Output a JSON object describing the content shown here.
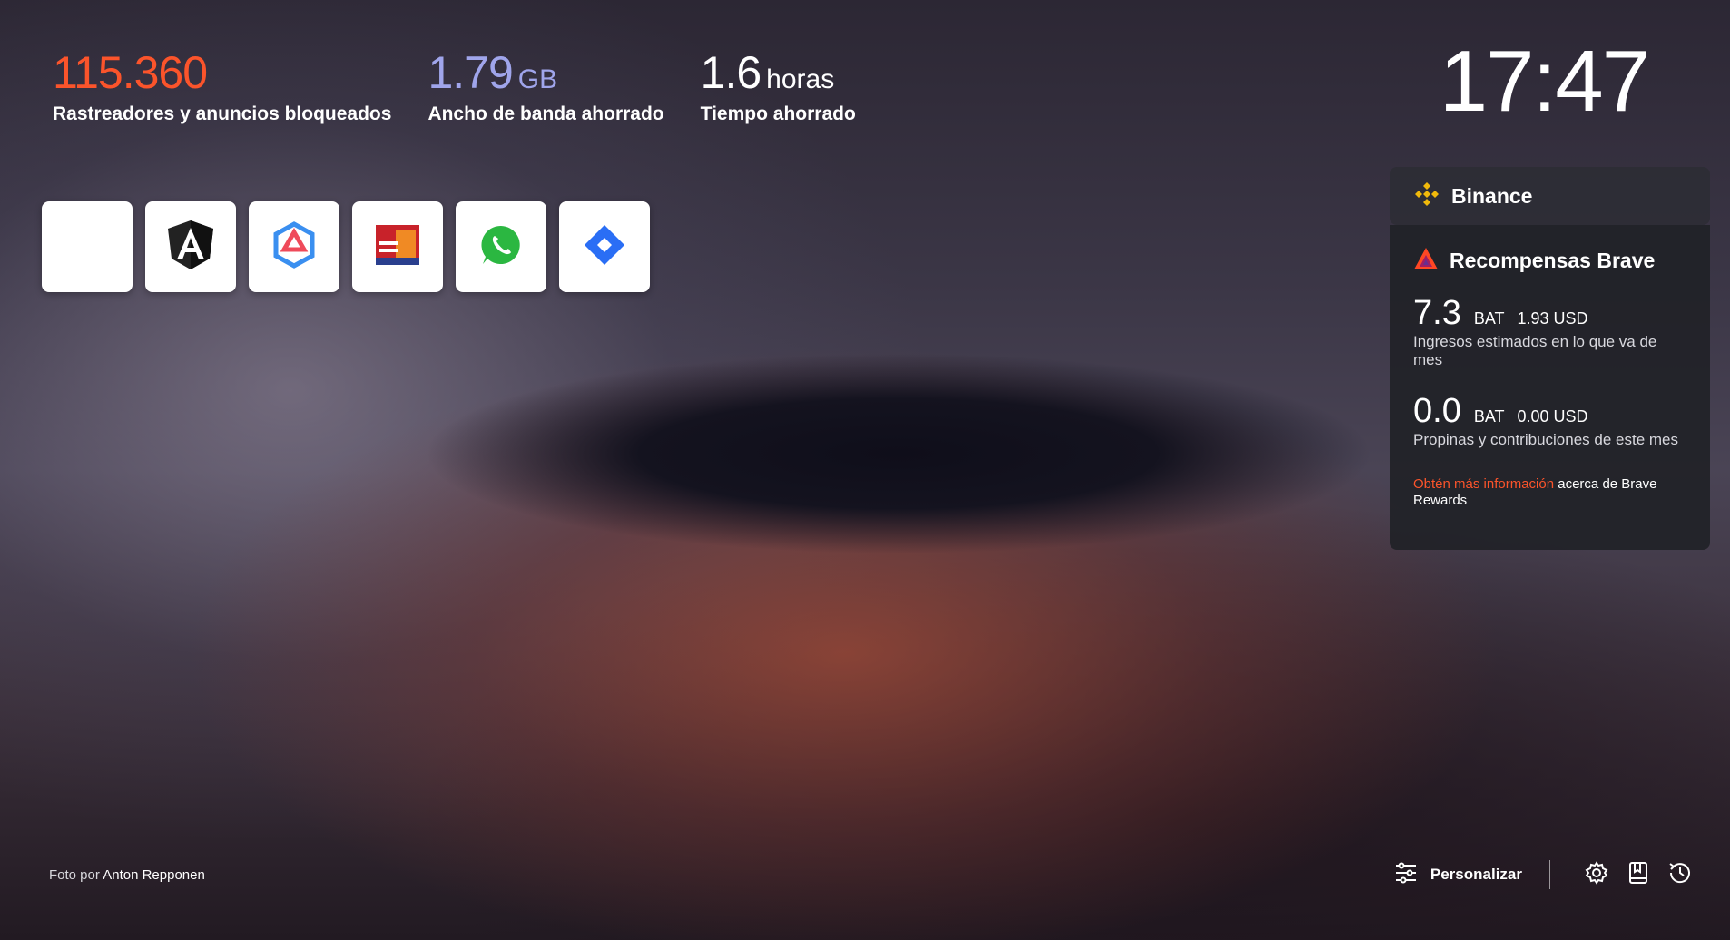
{
  "stats": {
    "trackers": {
      "value": "115.360",
      "label": "Rastreadores y anuncios bloqueados"
    },
    "bandwidth": {
      "value": "1.79",
      "unit": "GB",
      "label": "Ancho de banda ahorrado"
    },
    "time": {
      "value": "1.6",
      "unit": "horas",
      "label": "Tiempo ahorrado"
    }
  },
  "clock": {
    "time": "17:47"
  },
  "top_sites": [
    {
      "icon": "blank-site-icon"
    },
    {
      "icon": "angular-icon"
    },
    {
      "icon": "hexagon-app-icon"
    },
    {
      "icon": "building-site-icon"
    },
    {
      "icon": "whatsapp-icon"
    },
    {
      "icon": "jira-icon"
    }
  ],
  "binance": {
    "title": "Binance",
    "icon": "binance-icon"
  },
  "rewards": {
    "title": "Recompensas Brave",
    "icon": "bat-icon",
    "earnings": {
      "bat": "7.3",
      "bat_unit": "BAT",
      "usd": "1.93 USD",
      "description": "Ingresos estimados en lo que va de mes"
    },
    "tips": {
      "bat": "0.0",
      "bat_unit": "BAT",
      "usd": "0.00 USD",
      "description": "Propinas y contribuciones de este mes"
    },
    "learn_more_link": "Obtén más información",
    "learn_more_rest": "acerca de Brave Rewards"
  },
  "credit": {
    "prefix": "Foto por",
    "name": "Anton Repponen"
  },
  "bottom_bar": {
    "customize_label": "Personalizar",
    "icons": [
      "sliders-icon",
      "gear-icon",
      "bookmark-icon",
      "history-icon"
    ]
  },
  "colors": {
    "trackers": "#fb542b",
    "bandwidth": "#a0a5eb",
    "link": "#fb542b",
    "binance_yellow": "#f0b90b"
  }
}
